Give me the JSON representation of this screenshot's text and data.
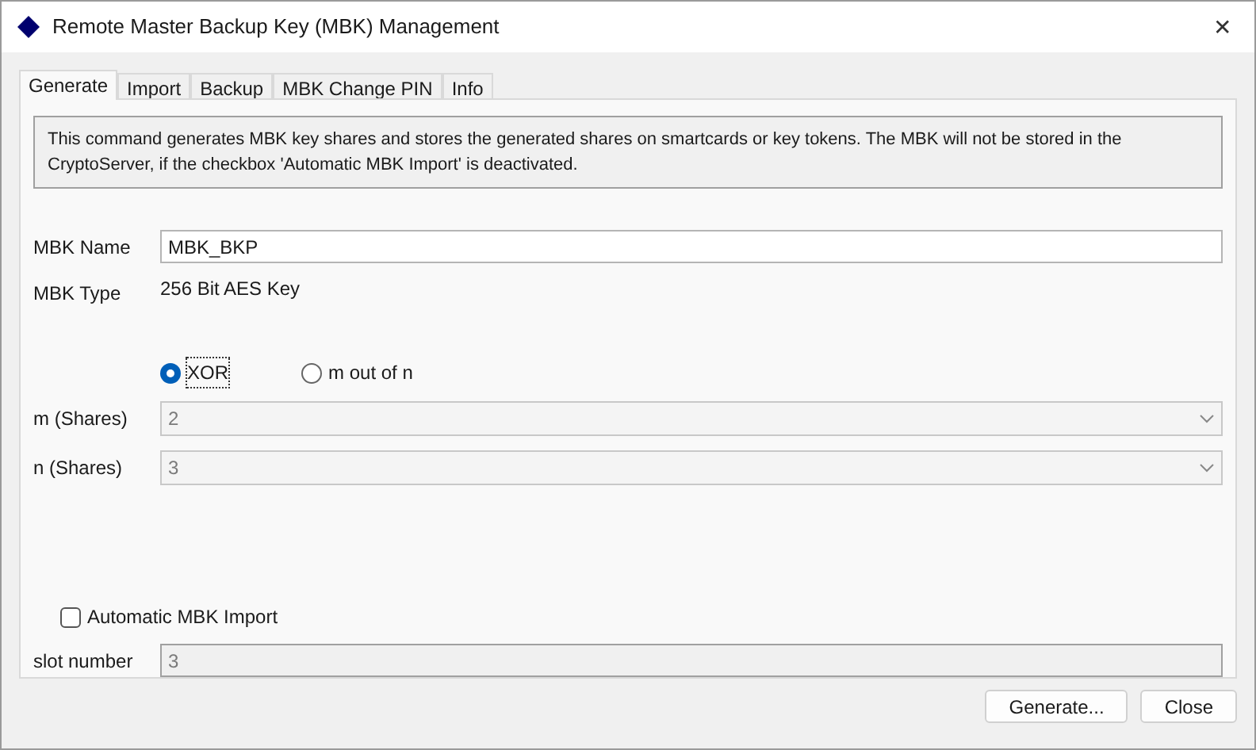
{
  "window": {
    "title": "Remote Master Backup Key (MBK) Management",
    "close": "✕"
  },
  "tabs": [
    {
      "label": "Generate",
      "selected": true
    },
    {
      "label": "Import",
      "selected": false
    },
    {
      "label": "Backup",
      "selected": false
    },
    {
      "label": "MBK Change PIN",
      "selected": false
    },
    {
      "label": "Info",
      "selected": false
    }
  ],
  "description": "This command generates MBK key shares and stores the generated shares on smartcards or key tokens. The MBK will not be stored in the CryptoServer, if the checkbox 'Automatic MBK Import' is deactivated.",
  "mbk_name": {
    "label": "MBK Name",
    "value": "MBK_BKP"
  },
  "mbk_type": {
    "label": "MBK Type",
    "value": "256 Bit AES Key"
  },
  "modes": [
    {
      "label": "XOR",
      "selected": true
    },
    {
      "label": "m out of n",
      "selected": false
    }
  ],
  "m_shares": {
    "label": "m (Shares)",
    "value": "2",
    "disabled": true
  },
  "n_shares": {
    "label": "n (Shares)",
    "value": "3",
    "disabled": true
  },
  "auto_import": {
    "label": "Automatic MBK Import",
    "checked": false
  },
  "slot_number": {
    "label": "slot number",
    "value": "3",
    "disabled": true
  },
  "buttons": [
    "Generate...",
    "Close"
  ]
}
